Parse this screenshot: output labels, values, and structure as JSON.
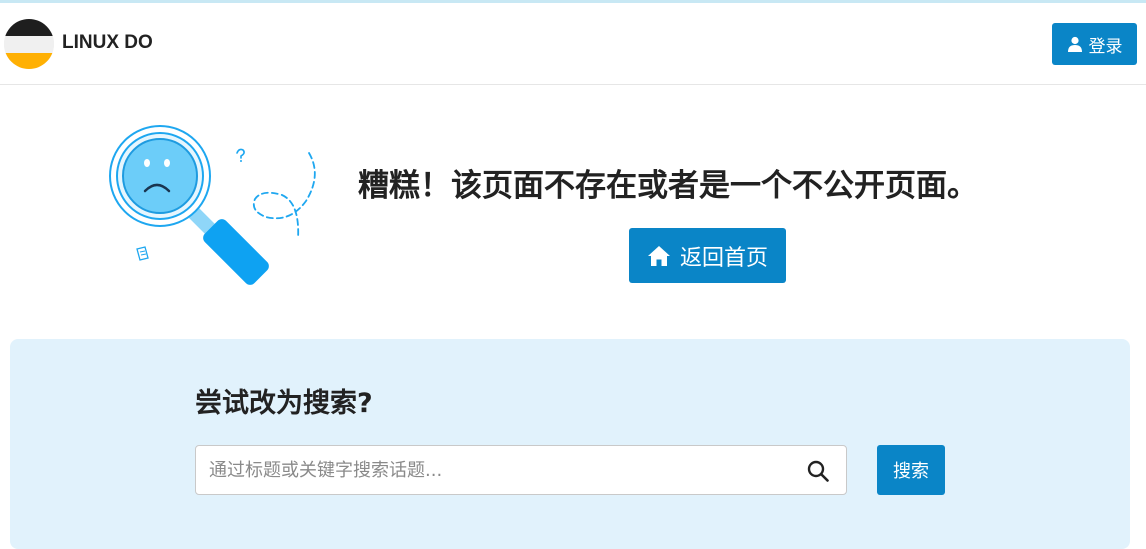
{
  "header": {
    "site_title": "LINUX DO",
    "login_label": "登录",
    "logo": {
      "colors": [
        "#1e1e1e",
        "#f0f0f0",
        "#ffb003"
      ]
    }
  },
  "not_found": {
    "headline": "糟糕！该页面不存在或者是一个不公开页面。",
    "home_button_label": "返回首页",
    "illustration_icon": "sad-magnifier-illustration"
  },
  "search": {
    "heading": "尝试改为搜索?",
    "placeholder": "通过标题或关键字搜索话题...",
    "value": "",
    "button_label": "搜索"
  },
  "colors": {
    "accent": "#0a85c7",
    "panel_background": "#e1f2fc",
    "illustration_blue": "#1ea7f0"
  }
}
